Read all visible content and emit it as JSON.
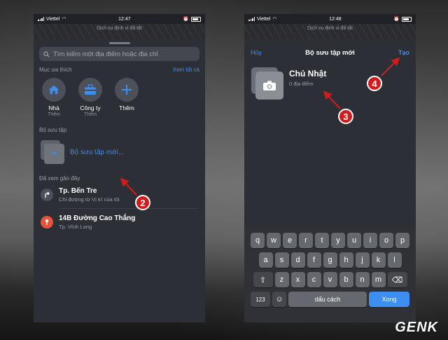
{
  "left": {
    "status": {
      "carrier": "Viettel",
      "time": "12:47"
    },
    "location_banner": "Dịch vụ định vị đã tắt",
    "search_placeholder": "Tìm kiếm một địa điểm hoặc địa chỉ",
    "favorites": {
      "heading": "Mục ưa thích",
      "see_all": "Xem tất cả",
      "items": [
        {
          "label": "Nhà",
          "sub": "Thêm",
          "icon": "home-icon"
        },
        {
          "label": "Công ty",
          "sub": "Thêm",
          "icon": "briefcase-icon"
        },
        {
          "label": "Thêm",
          "sub": "",
          "icon": "plus-icon"
        }
      ]
    },
    "collections": {
      "heading": "Bộ sưu tập",
      "new_label": "Bộ sưu tập mới..."
    },
    "recents": {
      "heading": "Đã xem gần đây",
      "items": [
        {
          "title": "Tp. Bến Tre",
          "subtitle": "Chỉ đường từ Vị trí của tôi",
          "icon": "directions-icon",
          "color": "#4c5058"
        },
        {
          "title": "14B Đường Cao Thắng",
          "subtitle": "Tp. Vĩnh Long",
          "icon": "pin-icon",
          "color": "#e5533d"
        }
      ]
    }
  },
  "right": {
    "status": {
      "carrier": "Viettel",
      "time": "12:48"
    },
    "location_banner": "Dịch vụ định vị đã tắt",
    "nav": {
      "cancel": "Hủy",
      "title": "Bộ sưu tập mới",
      "create": "Tạo"
    },
    "new_collection": {
      "name": "Chủ Nhật",
      "count": "0 địa điểm"
    },
    "keyboard": {
      "row1": [
        "q",
        "w",
        "e",
        "r",
        "t",
        "y",
        "u",
        "i",
        "o",
        "p"
      ],
      "row2": [
        "a",
        "s",
        "d",
        "f",
        "g",
        "h",
        "j",
        "k",
        "l"
      ],
      "row3": [
        "z",
        "x",
        "c",
        "v",
        "b",
        "n",
        "m"
      ],
      "numbers": "123",
      "space": "dấu cách",
      "done": "Xong"
    }
  },
  "annotations": {
    "step2": "2",
    "step3": "3",
    "step4": "4"
  },
  "colors": {
    "accent": "#3d8ef0",
    "badge": "#d21c1c"
  },
  "watermark": "GENK"
}
